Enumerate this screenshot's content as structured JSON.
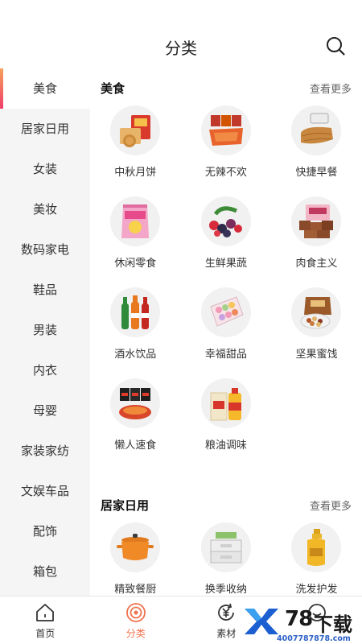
{
  "header": {
    "title": "分类"
  },
  "sidebar": {
    "items": [
      {
        "label": "美食",
        "active": true
      },
      {
        "label": "居家日用"
      },
      {
        "label": "女装"
      },
      {
        "label": "美妆"
      },
      {
        "label": "数码家电"
      },
      {
        "label": "鞋品"
      },
      {
        "label": "男装"
      },
      {
        "label": "内衣"
      },
      {
        "label": "母婴"
      },
      {
        "label": "家装家纺"
      },
      {
        "label": "文娱车品"
      },
      {
        "label": "配饰"
      },
      {
        "label": "箱包"
      }
    ]
  },
  "sections": [
    {
      "title": "美食",
      "more": "查看更多",
      "items": [
        {
          "label": "中秋月饼",
          "icon": "mooncake-icon"
        },
        {
          "label": "无辣不欢",
          "icon": "spicy-snack-icon"
        },
        {
          "label": "快捷早餐",
          "icon": "bread-icon"
        },
        {
          "label": "休闲零食",
          "icon": "snack-bag-icon"
        },
        {
          "label": "生鲜果蔬",
          "icon": "berries-icon"
        },
        {
          "label": "肉食主义",
          "icon": "meat-icon"
        },
        {
          "label": "酒水饮品",
          "icon": "bottles-icon"
        },
        {
          "label": "幸福甜品",
          "icon": "macaron-icon"
        },
        {
          "label": "坚果蜜饯",
          "icon": "nuts-icon"
        },
        {
          "label": "懒人速食",
          "icon": "noodles-icon"
        },
        {
          "label": "粮油调味",
          "icon": "oil-rice-icon"
        }
      ]
    },
    {
      "title": "居家日用",
      "more": "查看更多",
      "items": [
        {
          "label": "精致餐厨",
          "icon": "pot-icon"
        },
        {
          "label": "换季收纳",
          "icon": "storage-box-icon"
        },
        {
          "label": "洗发护发",
          "icon": "shampoo-icon"
        }
      ]
    }
  ],
  "tabbar": {
    "tabs": [
      {
        "label": "首页",
        "icon": "home-icon"
      },
      {
        "label": "分类",
        "icon": "category-icon",
        "active": true
      },
      {
        "label": "素材",
        "icon": "material-icon"
      },
      {
        "label": "",
        "icon": "profile-icon"
      }
    ]
  },
  "watermark": {
    "brand": "78",
    "suffix": "下载",
    "url": "4007787878.com"
  },
  "colors": {
    "accent": "#f0714c",
    "sidebar_bg": "#f5f5f5"
  }
}
